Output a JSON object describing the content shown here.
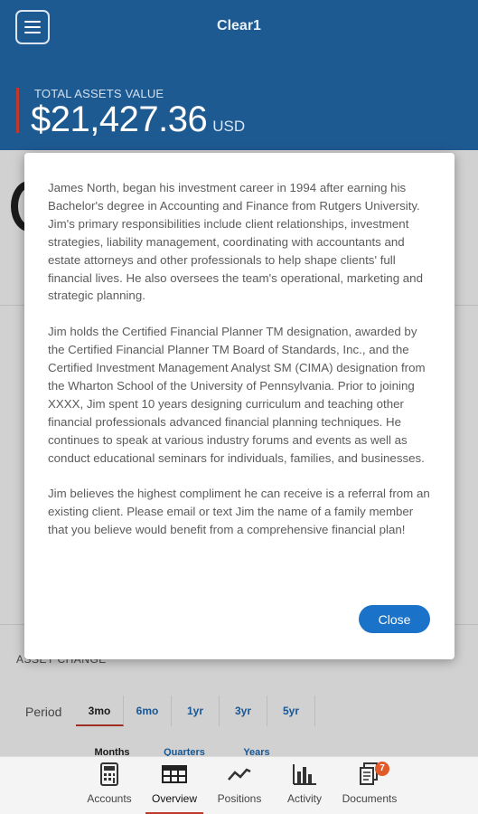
{
  "app": {
    "title": "Clear1"
  },
  "summary": {
    "label": "TOTAL ASSETS VALUE",
    "value": "$21,427.36",
    "currency": "USD"
  },
  "background": {
    "asset_change_title": "ASSET CHANGE",
    "period_label": "Period",
    "period_tabs": [
      "3mo",
      "6mo",
      "1yr",
      "3yr",
      "5yr"
    ],
    "period_selected": "3mo",
    "row2_tabs": [
      "Months",
      "Quarters",
      "Years"
    ]
  },
  "modal": {
    "paragraphs": [
      "James North, began his investment career in 1994 after earning his Bachelor's degree in Accounting and Finance from Rutgers University. Jim's primary responsibilities include client relationships, investment strategies, liability management, coordinating with accountants and estate attorneys and other professionals to help shape clients' full financial lives. He also oversees the team's operational, marketing and strategic planning.",
      "Jim holds the Certified Financial Planner TM designation, awarded by the Certified Financial Planner TM Board of Standards, Inc., and the Certified Investment Management Analyst SM (CIMA) designation from the Wharton School of the University of Pennsylvania. Prior to joining XXXX, Jim spent 10 years designing curriculum and teaching other financial professionals advanced financial planning techniques. He continues to speak at various industry forums and events as well as conduct educational seminars for individuals, families, and businesses.",
      "Jim believes the highest compliment he can receive is a referral from an existing client. Please email or text Jim the name of a family member that you believe would benefit from a comprehensive financial plan!"
    ],
    "close_label": "Close"
  },
  "bottom_nav": {
    "items": [
      {
        "label": "Accounts",
        "icon": "calculator-icon"
      },
      {
        "label": "Overview",
        "icon": "grid-table-icon"
      },
      {
        "label": "Positions",
        "icon": "line-chart-icon"
      },
      {
        "label": "Activity",
        "icon": "bar-chart-icon"
      },
      {
        "label": "Documents",
        "icon": "documents-icon"
      }
    ],
    "active": "Overview",
    "documents_badge": "7"
  },
  "colors": {
    "header": "#1e5a92",
    "accent_red": "#c0392b",
    "button_blue": "#1a73c8",
    "badge": "#e05a2a"
  }
}
